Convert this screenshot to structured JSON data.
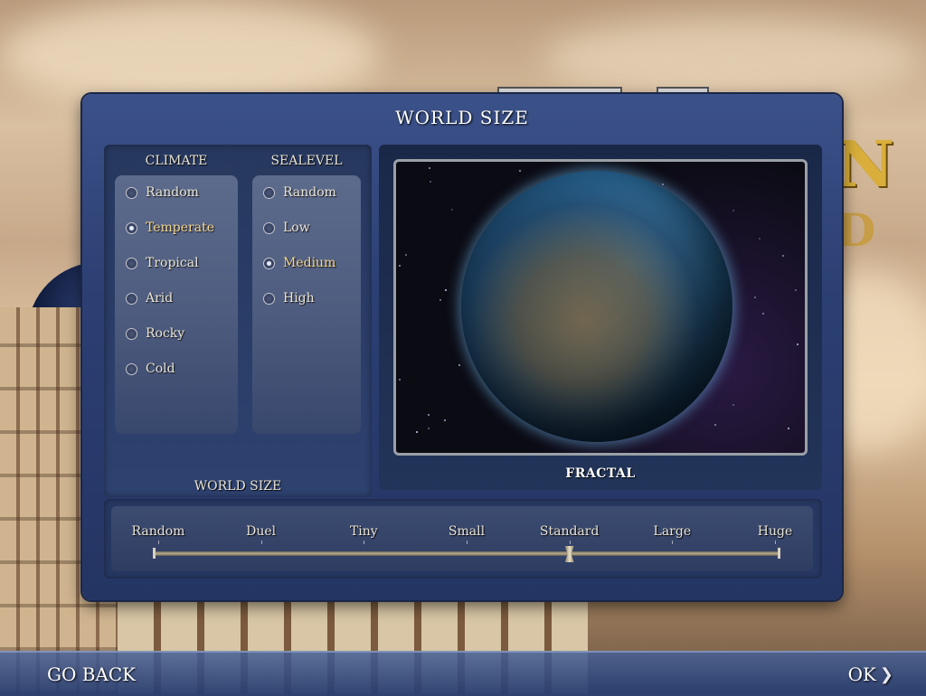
{
  "dialog": {
    "title": "WORLD SIZE"
  },
  "climate": {
    "header": "CLIMATE",
    "options": [
      "Random",
      "Temperate",
      "Tropical",
      "Arid",
      "Rocky",
      "Cold"
    ],
    "selected": "Temperate"
  },
  "sealevel": {
    "header": "SEALEVEL",
    "options": [
      "Random",
      "Low",
      "Medium",
      "High"
    ],
    "selected": "Medium"
  },
  "world_size": {
    "label": "WORLD SIZE",
    "options": [
      "Random",
      "Duel",
      "Tiny",
      "Small",
      "Standard",
      "Large",
      "Huge"
    ],
    "selected": "Standard"
  },
  "preview": {
    "map_type": "FRACTAL"
  },
  "footer": {
    "back_label": "GO BACK",
    "ok_label": "OK"
  },
  "icons": {
    "ok_arrow": "chevron-right-icon"
  },
  "colors": {
    "selected_text": "#f4d690",
    "dialog_bg": "#2c3f73"
  }
}
